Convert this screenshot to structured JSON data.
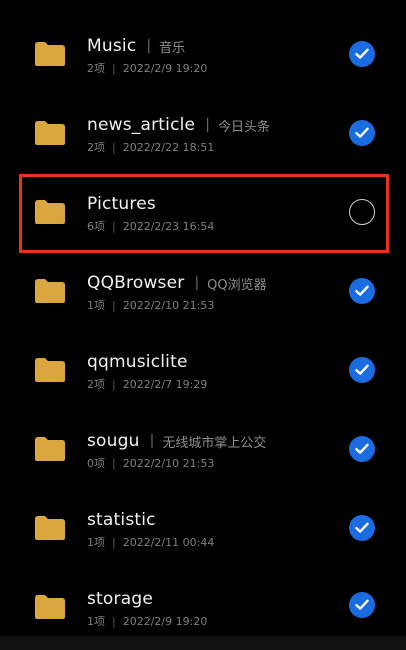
{
  "colors": {
    "background": "#000000",
    "folder": "#d9a640",
    "check_selected": "#1b6ce0",
    "highlight_box": "#e8321e"
  },
  "rows": [
    {
      "name": "Music",
      "alias": "音乐",
      "count": "2项",
      "date": "2022/2/9 19:20",
      "selected": true,
      "icon": "folder-icon"
    },
    {
      "name": "news_article",
      "alias": "今日头条",
      "count": "2项",
      "date": "2022/2/22 18:51",
      "selected": true,
      "icon": "folder-icon"
    },
    {
      "name": "Pictures",
      "alias": "",
      "count": "6项",
      "date": "2022/2/23 16:54",
      "selected": false,
      "icon": "folder-icon"
    },
    {
      "name": "QQBrowser",
      "alias": "QQ浏览器",
      "count": "1项",
      "date": "2022/2/10 21:53",
      "selected": true,
      "icon": "folder-icon"
    },
    {
      "name": "qqmusiclite",
      "alias": "",
      "count": "2项",
      "date": "2022/2/7 19:29",
      "selected": true,
      "icon": "folder-icon"
    },
    {
      "name": "sougu",
      "alias": "无线城市掌上公交",
      "count": "0项",
      "date": "2022/2/10 21:53",
      "selected": true,
      "icon": "folder-icon"
    },
    {
      "name": "statistic",
      "alias": "",
      "count": "1项",
      "date": "2022/2/11 00:44",
      "selected": true,
      "icon": "folder-icon"
    },
    {
      "name": "storage",
      "alias": "",
      "count": "1项",
      "date": "2022/2/9 19:20",
      "selected": true,
      "icon": "folder-icon"
    }
  ]
}
